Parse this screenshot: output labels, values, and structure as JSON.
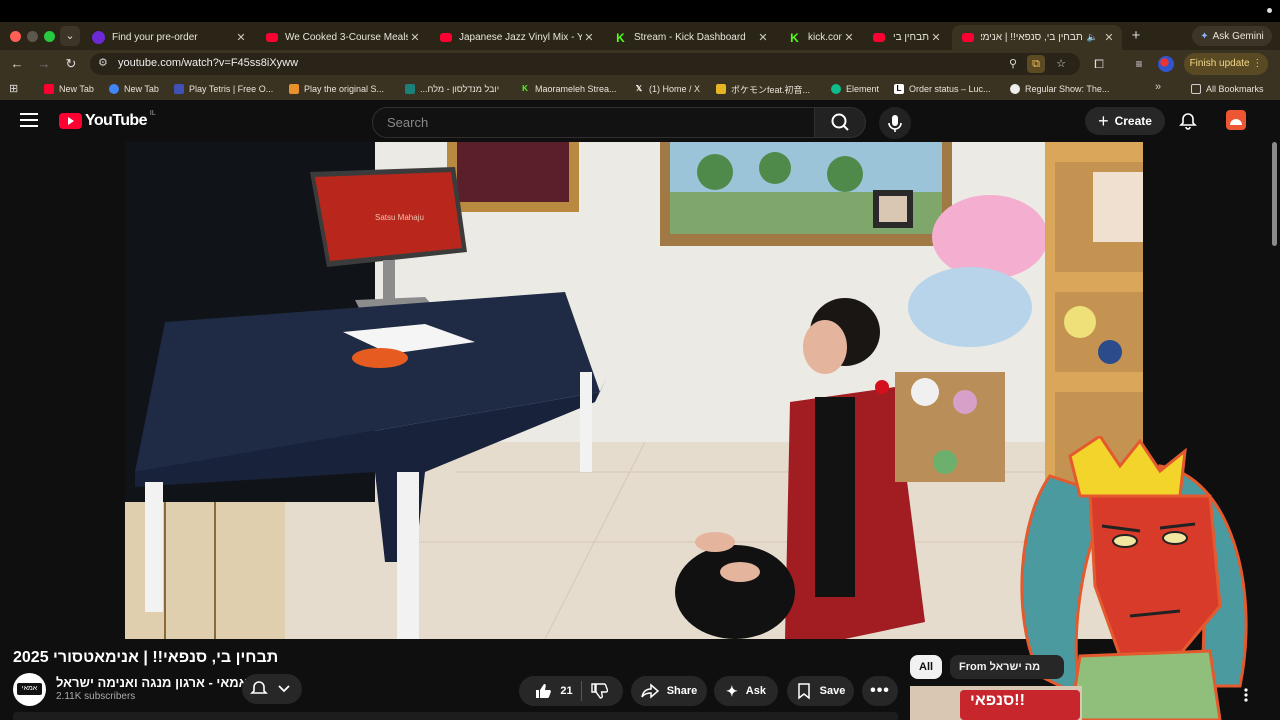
{
  "browser": {
    "tabs": [
      {
        "title": "Find your pre-order",
        "favicon": "purple-circle"
      },
      {
        "title": "We Cooked 3-Course Meals",
        "favicon": "youtube"
      },
      {
        "title": "Japanese Jazz Vinyl Mix - Yo",
        "favicon": "youtube"
      },
      {
        "title": "Stream - Kick Dashboard",
        "favicon": "kick"
      },
      {
        "title": "kick.com",
        "favicon": "kick"
      },
      {
        "title": "תבחין בי",
        "favicon": "youtube"
      },
      {
        "title": "תבחין בי, סנפאי!! | אנימא",
        "favicon": "youtube",
        "active": true
      }
    ],
    "gemini_label": "Ask Gemini",
    "url": "youtube.com/watch?v=F45ss8iXyww",
    "finish_update_label": "Finish update",
    "bookmarks": [
      {
        "label": "New Tab",
        "favicon": "youtube"
      },
      {
        "label": "New Tab",
        "favicon": "chrome"
      },
      {
        "label": "Play Tetris | Free O...",
        "favicon": "tetris"
      },
      {
        "label": "Play the original S...",
        "favicon": "snake"
      },
      {
        "label": "יובל מנדלסון - מלח...",
        "favicon": "teal"
      },
      {
        "label": "Maorameleh Strea...",
        "favicon": "kick"
      },
      {
        "label": "(1) Home / X",
        "favicon": "x"
      },
      {
        "label": "ポケモンfeat.初音...",
        "favicon": "yellow"
      },
      {
        "label": "Element",
        "favicon": "element"
      },
      {
        "label": "Order status – Luc...",
        "favicon": "l"
      },
      {
        "label": "Regular Show: The...",
        "favicon": "circle"
      }
    ],
    "all_bookmarks_label": "All Bookmarks",
    "colors": {
      "tab_strip": "#2b2517",
      "toolbar": "#3a3322",
      "accent": "#f3d98a"
    }
  },
  "youtube": {
    "logo_text": "YouTube",
    "country_code": "IL",
    "search_placeholder": "Search",
    "create_label": "Create",
    "video": {
      "title": "תבחין בי, סנפאי!! | אנימאטסורי 2025",
      "monitor_text": "Satsu Mahaju"
    },
    "channel": {
      "name": "אמאי - ארגון מנגה ואנימה ישראל",
      "subscribers": "2.11K subscribers",
      "avatar_text": "אמאי"
    },
    "actions": {
      "likes": "21",
      "share": "Share",
      "ask": "Ask",
      "save": "Save"
    },
    "chips": {
      "all": "All",
      "from": "From מה ישראל"
    },
    "thumbnail_text": "סנפאי!!"
  }
}
